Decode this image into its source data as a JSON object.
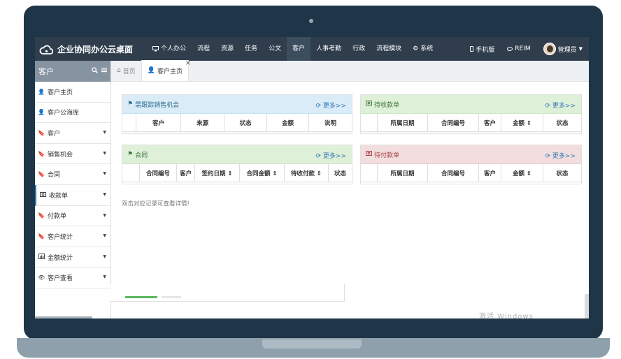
{
  "app": {
    "title": "企业协同办公云桌面"
  },
  "topnav": {
    "items": [
      {
        "label": "个人办公",
        "icon": "monitor-icon"
      },
      {
        "label": "流程"
      },
      {
        "label": "资源"
      },
      {
        "label": "任务"
      },
      {
        "label": "公文"
      },
      {
        "label": "客户",
        "active": true
      },
      {
        "label": "人事考勤"
      },
      {
        "label": "行政"
      },
      {
        "label": "流程模块"
      },
      {
        "label": "系统",
        "icon": "gear-icon"
      }
    ],
    "right": {
      "mobile_label": "手机版",
      "reim_label": "REIM",
      "user_label": "管理员"
    }
  },
  "sidebar": {
    "title": "客户",
    "items": [
      {
        "label": "客户主页",
        "icon": "user-icon",
        "caret": false
      },
      {
        "label": "客户公海库",
        "icon": "user-icon",
        "caret": false
      },
      {
        "label": "客户",
        "icon": "bookmark-icon",
        "caret": true
      },
      {
        "label": "销售机会",
        "icon": "bookmark-icon",
        "caret": true
      },
      {
        "label": "合同",
        "icon": "bookmark-icon",
        "caret": true
      },
      {
        "label": "收款单",
        "icon": "money-icon",
        "caret": true
      },
      {
        "label": "付款单",
        "icon": "bookmark-icon",
        "caret": true
      },
      {
        "label": "客户统计",
        "icon": "bookmark-icon",
        "caret": true
      },
      {
        "label": "金额统计",
        "icon": "chart-icon",
        "caret": true
      },
      {
        "label": "客户查看",
        "icon": "eye-icon",
        "caret": true
      }
    ]
  },
  "tabs": [
    {
      "label": "首页",
      "icon": "home-icon"
    },
    {
      "label": "客户主页",
      "icon": "user-icon",
      "active": true
    }
  ],
  "panels": {
    "opportunity": {
      "title": "需跟踪销售机会",
      "more": "更多>>",
      "columns": [
        "",
        "客户",
        "来源",
        "状态",
        "金额",
        "说明"
      ]
    },
    "receipt": {
      "title": "待收款单",
      "more": "更多>>",
      "columns": [
        "",
        "所属日期",
        "合同编号",
        "客户",
        "金额 ⇕",
        "状态"
      ]
    },
    "contract": {
      "title": "合同",
      "more": "更多>>",
      "columns": [
        "",
        "合同编号",
        "客户",
        "签约日期 ⇕",
        "合同金额 ⇕",
        "待收付款 ⇕",
        "状态"
      ]
    },
    "payment": {
      "title": "待付款单",
      "more": "更多>>",
      "columns": [
        "",
        "所属日期",
        "合同编号",
        "客户",
        "金额 ⇕",
        "状态"
      ]
    }
  },
  "hint": "双击对应记录可查看详情!",
  "watermark": "激活 Windows",
  "colors": {
    "topbar": "#2f3d4c",
    "frame": "#1f3548",
    "info_blue": "#d9ecf7",
    "success_green": "#dff0d8",
    "danger_red": "#f2dede",
    "link": "#337ab7"
  }
}
